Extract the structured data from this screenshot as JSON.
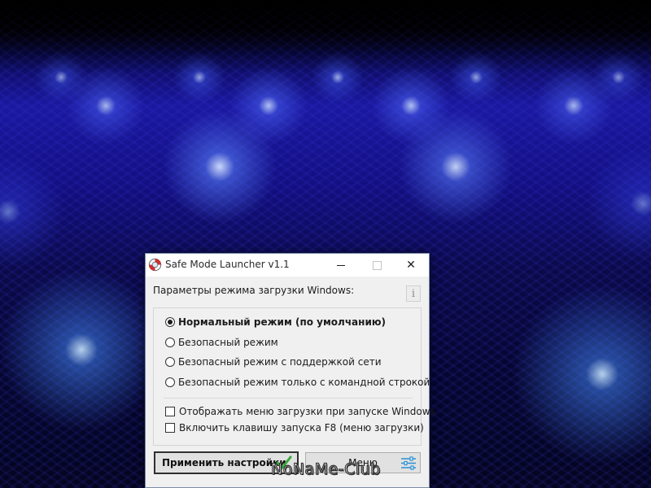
{
  "window": {
    "title": "Safe Mode Launcher v1.1",
    "close_glyph": "✕"
  },
  "content": {
    "params_label": "Параметры режима загрузки Windows:",
    "info_glyph": "i",
    "options": [
      {
        "label": "Нормальный режим (по умолчанию)",
        "selected": true
      },
      {
        "label": "Безопасный режим",
        "selected": false
      },
      {
        "label": "Безопасный режим с поддержкой сети",
        "selected": false
      },
      {
        "label": "Безопасный режим только с командной строкой",
        "selected": false
      }
    ],
    "checkboxes": [
      {
        "label": "Отображать меню загрузки при запуске Windows",
        "checked": false
      },
      {
        "label": "Включить клавишу запуска F8 (меню загрузки)",
        "checked": false
      }
    ]
  },
  "buttons": {
    "apply_label": "Применить настройки",
    "menu_label": "Меню"
  },
  "watermark": "NoNaMe-Club",
  "colors": {
    "check_green": "#3aa83a",
    "sliders_blue": "#2a8fd6",
    "app_icon_red": "#d62d2d"
  }
}
